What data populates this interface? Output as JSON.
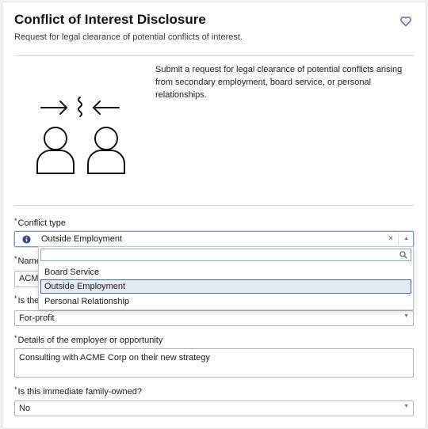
{
  "header": {
    "title": "Conflict of Interest Disclosure",
    "subtitle": "Request for legal clearance of potential conflicts of interest."
  },
  "intro": {
    "text": "Submit a request for legal clearance of potential conflicts arising from secondary employment, board service, or personal relationships."
  },
  "form": {
    "required_mark": "*",
    "conflict_type": {
      "label": "Conflict type",
      "value": "Outside Employment",
      "clear_symbol": "×",
      "caret": "▲"
    },
    "name": {
      "label": "Name",
      "value": "ACM"
    },
    "is_the": {
      "label": "Is the",
      "value": "For-profit",
      "caret": "▼"
    },
    "details": {
      "label": "Details of the employer or opportunity",
      "value": "Consulting with ACME Corp on their new strategy"
    },
    "family_owned": {
      "label": "Is this immediate family-owned?",
      "value": "No",
      "caret": "▼"
    }
  },
  "dropdown": {
    "search_value": "",
    "options": [
      "Board Service",
      "Outside Employment",
      "Personal Relationship"
    ],
    "selected": "Outside Employment"
  },
  "colors": {
    "accent": "#4a63a8",
    "selected_bg": "#e6eaf5",
    "focus_border": "#7b97c9"
  },
  "icons": [
    "heart-icon",
    "info-icon",
    "search-icon",
    "people-conflict-illustration"
  ]
}
